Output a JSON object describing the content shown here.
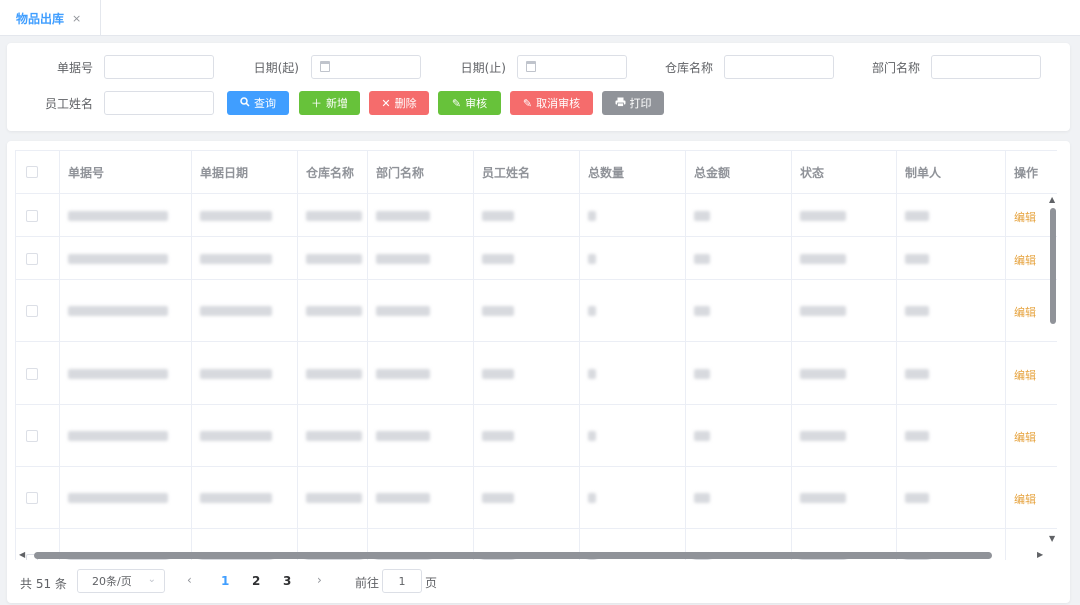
{
  "tab": {
    "label": "物品出库",
    "close": "×"
  },
  "filters": {
    "doc_no": "单据号",
    "date_start": "日期(起)",
    "date_end": "日期(止)",
    "warehouse": "仓库名称",
    "department": "部门名称",
    "employee": "员工姓名"
  },
  "buttons": {
    "query": {
      "label": "查询",
      "icon": "search-icon",
      "color": "#409eff"
    },
    "add": {
      "label": "新增",
      "icon": "plus-icon",
      "color": "#67c23a"
    },
    "delete": {
      "label": "删除",
      "icon": "x-icon",
      "color": "#f56c6c"
    },
    "audit": {
      "label": "审核",
      "icon": "edit-icon",
      "color": "#67c23a"
    },
    "cancel_audit": {
      "label": "取消审核",
      "icon": "edit-icon",
      "color": "#f56c6c"
    },
    "print": {
      "label": "打印",
      "icon": "printer-icon",
      "color": "#909399"
    }
  },
  "table": {
    "headers": [
      "单据号",
      "单据日期",
      "仓库名称",
      "部门名称",
      "员工姓名",
      "总数量",
      "总金额",
      "状态",
      "制单人",
      "操作"
    ],
    "row_action": "编辑",
    "row_count_visible": 7
  },
  "pagination": {
    "total": "共 51 条",
    "page_size": "20条/页",
    "pages": [
      "1",
      "2",
      "3"
    ],
    "current_page": "1",
    "goto_label": "前往",
    "goto_value": "1",
    "page_suffix": "页"
  },
  "colors": {
    "accent": "#409eff",
    "edit_link": "#e6a23c"
  }
}
